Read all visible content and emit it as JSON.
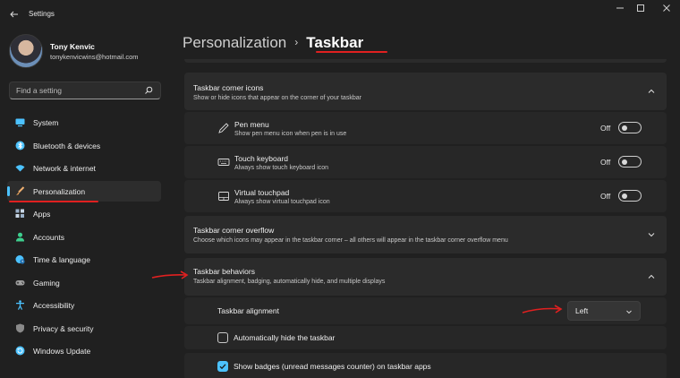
{
  "window": {
    "title": "Settings",
    "back_icon": "arrow-left-icon",
    "controls": [
      "minimize-icon",
      "maximize-icon",
      "close-icon"
    ]
  },
  "profile": {
    "name": "Tony Kenvic",
    "email": "tonykenvicwins@hotmail.com"
  },
  "search": {
    "placeholder": "Find a setting"
  },
  "sidebar": {
    "items": [
      {
        "label": "System",
        "icon": "monitor-icon",
        "color": "#4cc2ff"
      },
      {
        "label": "Bluetooth & devices",
        "icon": "bluetooth-icon",
        "color": "#4cc2ff"
      },
      {
        "label": "Network & internet",
        "icon": "wifi-icon",
        "color": "#4cc2ff"
      },
      {
        "label": "Personalization",
        "icon": "paintbrush-icon",
        "color": "#e8a25a",
        "active": true
      },
      {
        "label": "Apps",
        "icon": "apps-icon",
        "color": "#9ab0c8"
      },
      {
        "label": "Accounts",
        "icon": "person-icon",
        "color": "#3dcf8e"
      },
      {
        "label": "Time & language",
        "icon": "globe-clock-icon",
        "color": "#4cc2ff"
      },
      {
        "label": "Gaming",
        "icon": "gamepad-icon",
        "color": "#a0a0a0"
      },
      {
        "label": "Accessibility",
        "icon": "accessibility-icon",
        "color": "#4cc2ff"
      },
      {
        "label": "Privacy & security",
        "icon": "shield-icon",
        "color": "#8a8a8a"
      },
      {
        "label": "Windows Update",
        "icon": "update-icon",
        "color": "#4cc2ff"
      }
    ]
  },
  "header": {
    "parent": "Personalization",
    "separator": "›",
    "current": "Taskbar"
  },
  "sections": {
    "corner_icons": {
      "title": "Taskbar corner icons",
      "desc": "Show or hide icons that appear on the corner of your taskbar",
      "rows": [
        {
          "title": "Pen menu",
          "desc": "Show pen menu icon when pen is in use",
          "state": "Off",
          "icon": "pen-icon"
        },
        {
          "title": "Touch keyboard",
          "desc": "Always show touch keyboard icon",
          "state": "Off",
          "icon": "keyboard-icon"
        },
        {
          "title": "Virtual touchpad",
          "desc": "Always show virtual touchpad icon",
          "state": "Off",
          "icon": "touchpad-icon"
        }
      ]
    },
    "corner_overflow": {
      "title": "Taskbar corner overflow",
      "desc": "Choose which icons may appear in the taskbar corner – all others will appear in the taskbar corner overflow menu"
    },
    "behaviors": {
      "title": "Taskbar behaviors",
      "desc": "Taskbar alignment, badging, automatically hide, and multiple displays",
      "alignment_label": "Taskbar alignment",
      "alignment_value": "Left",
      "auto_hide_label": "Automatically hide the taskbar",
      "auto_hide_checked": false,
      "badges_label": "Show badges (unread messages counter) on taskbar apps",
      "badges_checked": true
    }
  },
  "colors": {
    "accent": "#4cc2ff",
    "annotation": "#e02020"
  }
}
